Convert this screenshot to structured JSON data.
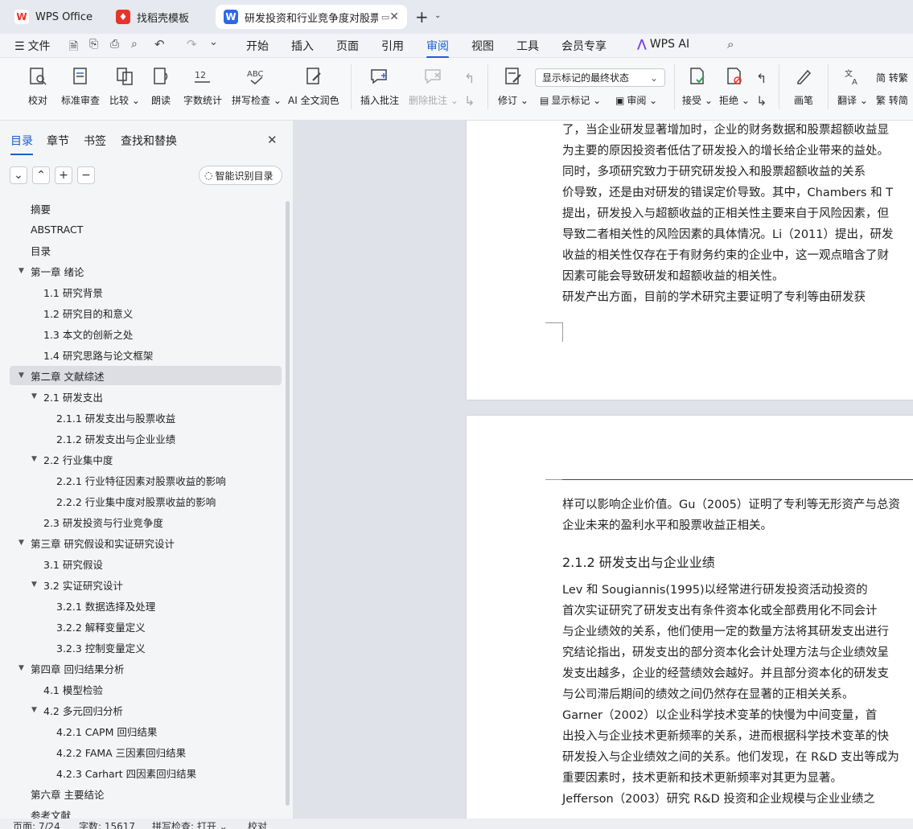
{
  "tabs": [
    {
      "label": "WPS Office",
      "icon": "wps-logo-icon"
    },
    {
      "label": "找稻壳模板",
      "icon": "docer-icon"
    },
    {
      "label": "研发投资和行业竞争度对股票",
      "icon": "word-doc-icon"
    }
  ],
  "menu": {
    "file": "文件",
    "items": [
      "开始",
      "插入",
      "页面",
      "引用",
      "审阅",
      "视图",
      "工具",
      "会员专享"
    ],
    "active": "审阅",
    "ai": "WPS AI"
  },
  "ribbon": {
    "proofread": "校对",
    "standard_review": "标准审查",
    "compare": "比较",
    "read_aloud": "朗读",
    "word_count": "字数统计",
    "spell_check": "拼写检查",
    "ai_polish": "AI 全文润色",
    "insert_comment": "插入批注",
    "delete_comment": "删除批注",
    "track": "修订",
    "markup_select": "显示标记的最终状态",
    "show_markup": "显示标记",
    "review_pane": "审阅",
    "accept": "接受",
    "reject": "拒绝",
    "ink": "画笔",
    "translate": "翻译",
    "to_trad": "转繁",
    "to_simp": "转简"
  },
  "panel": {
    "tabs": [
      "目录",
      "章节",
      "书签",
      "查找和替换"
    ],
    "active_tab": "目录",
    "smart_button": "智能识别目录",
    "toc": [
      {
        "text": "摘要",
        "level": 0,
        "arrow": false
      },
      {
        "text": "ABSTRACT",
        "level": 0,
        "arrow": false
      },
      {
        "text": "目录",
        "level": 0,
        "arrow": false
      },
      {
        "text": "第一章   绪论",
        "level": 0,
        "arrow": true
      },
      {
        "text": "1.1   研究背景",
        "level": 1,
        "arrow": false
      },
      {
        "text": "1.2   研究目的和意义",
        "level": 1,
        "arrow": false
      },
      {
        "text": "1.3   本文的创新之处",
        "level": 1,
        "arrow": false
      },
      {
        "text": "1.4   研究思路与论文框架",
        "level": 1,
        "arrow": false
      },
      {
        "text": "第二章   文献综述",
        "level": 0,
        "arrow": true,
        "selected": true
      },
      {
        "text": "2.1   研发支出",
        "level": 1,
        "arrow": true
      },
      {
        "text": "2.1.1   研发支出与股票收益",
        "level": 2,
        "arrow": false
      },
      {
        "text": "2.1.2   研发支出与企业业绩",
        "level": 2,
        "arrow": false
      },
      {
        "text": "2.2   行业集中度",
        "level": 1,
        "arrow": true
      },
      {
        "text": "2.2.1   行业特征因素对股票收益的影响",
        "level": 2,
        "arrow": false
      },
      {
        "text": "2.2.2   行业集中度对股票收益的影响",
        "level": 2,
        "arrow": false
      },
      {
        "text": "2.3   研发投资与行业竞争度",
        "level": 1,
        "arrow": false
      },
      {
        "text": "第三章   研究假设和实证研究设计",
        "level": 0,
        "arrow": true
      },
      {
        "text": "3.1   研究假设",
        "level": 1,
        "arrow": false
      },
      {
        "text": "3.2   实证研究设计",
        "level": 1,
        "arrow": true
      },
      {
        "text": "3.2.1   数据选择及处理",
        "level": 2,
        "arrow": false
      },
      {
        "text": "3.2.2   解释变量定义",
        "level": 2,
        "arrow": false
      },
      {
        "text": "3.2.3   控制变量定义",
        "level": 2,
        "arrow": false
      },
      {
        "text": "第四章   回归结果分析",
        "level": 0,
        "arrow": true
      },
      {
        "text": "4.1   模型检验",
        "level": 1,
        "arrow": false
      },
      {
        "text": "4.2   多元回归分析",
        "level": 1,
        "arrow": true
      },
      {
        "text": "4.2.1   CAPM 回归结果",
        "level": 2,
        "arrow": false
      },
      {
        "text": "4.2.2   FAMA 三因素回归结果",
        "level": 2,
        "arrow": false
      },
      {
        "text": "4.2.3   Carhart 四因素回归结果",
        "level": 2,
        "arrow": false
      },
      {
        "text": "第六章   主要结论",
        "level": 0,
        "arrow": false
      },
      {
        "text": "参考文献",
        "level": 0,
        "arrow": false
      }
    ]
  },
  "document": {
    "page1_lines": [
      "了，当企业研发显著增加时，企业的财务数据和股票超额收益显",
      "为主要的原因投资者低估了研发投入的增长给企业带来的益处。",
      "    同时，多项研究致力于研究研发投入和股票超额收益的关系",
      "价导致，还是由对研发的错误定价导致。其中，Chambers 和 T",
      "提出，研发投入与超额收益的正相关性主要来自于风险因素，但",
      "导致二者相关性的风险因素的具体情况。Li（2011）提出，研发",
      "收益的相关性仅存在于有财务约束的企业中，这一观点暗含了财",
      "因素可能会导致研发和超额收益的相关性。",
      "    研发产出方面，目前的学术研究主要证明了专利等由研发获"
    ],
    "page2_lines": [
      "样可以影响企业价值。Gu（2005）证明了专利等无形资产与总资",
      "企业未来的盈利水平和股票收益正相关。"
    ],
    "heading": "2.1.2   研发支出与企业业绩",
    "page2_body": [
      "    Lev 和 Sougiannis(1995)以经常进行研发投资活动投资的",
      "首次实证研究了研发支出有条件资本化或全部费用化不同会计",
      "与企业绩效的关系，他们使用一定的数量方法将其研发支出进行",
      "究结论指出，研发支出的部分资本化会计处理方法与企业绩效呈",
      "发支出越多，企业的经营绩效会越好。并且部分资本化的研发支",
      "与公司滞后期间的绩效之间仍然存在显著的正相关关系。",
      "    Garner（2002）以企业科学技术变革的快慢为中间变量，首",
      "出投入与企业技术更新频率的关系，进而根据科学技术变革的快",
      "研发投入与企业绩效之间的关系。他们发现，在 R&D 支出等成为",
      "重要因素时，技术更新和技术更新频率对其更为显著。",
      "    Jefferson（2003）研究 R&D 投资和企业规模与企业业绩之"
    ]
  },
  "status": {
    "page": "页面: 7/24",
    "words": "字数: 15617",
    "spell": "拼写检查: 打开",
    "proof": "校对"
  },
  "colors": {
    "accent": "#1a5fd0",
    "wps_red": "#e8332a"
  }
}
